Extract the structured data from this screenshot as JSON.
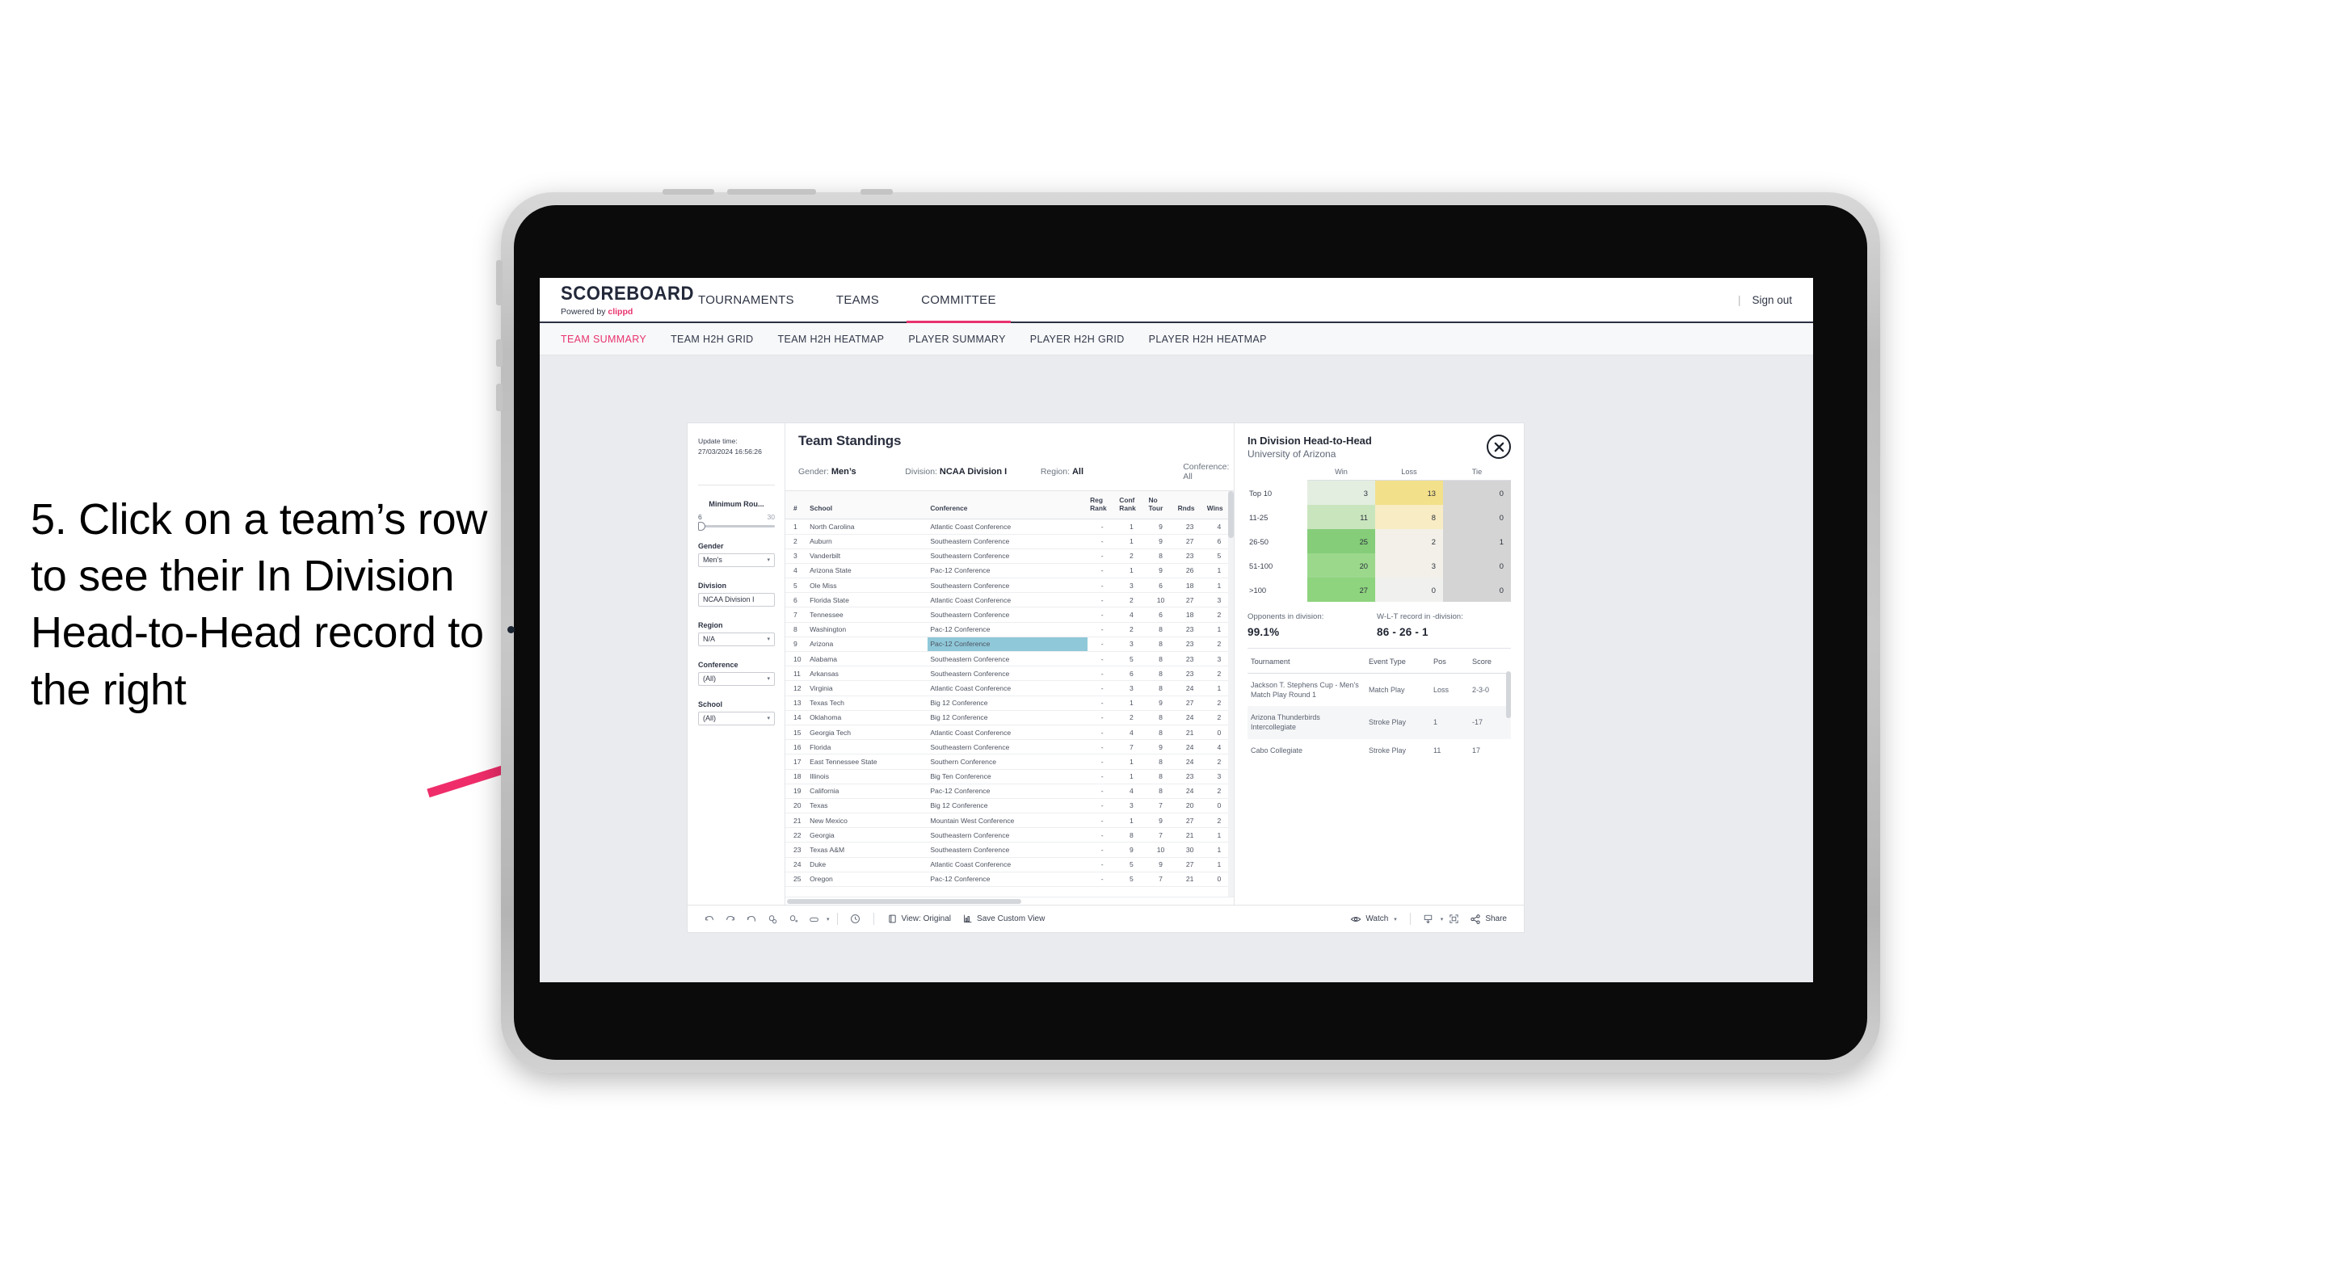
{
  "annotation": {
    "text": "5. Click on a team’s row to see their In Division Head-to-Head record to the right",
    "arrow_color": "#ef2d6a"
  },
  "topnav": {
    "brand_title": "SCOREBOARD",
    "brand_sub_prefix": "Powered by ",
    "brand_sub_accent": "clippd",
    "links": [
      {
        "label": "TOURNAMENTS",
        "active": false
      },
      {
        "label": "TEAMS",
        "active": false
      },
      {
        "label": "COMMITTEE",
        "active": true
      }
    ],
    "divider": "|",
    "signout": "Sign out"
  },
  "subnav": {
    "items": [
      {
        "label": "TEAM SUMMARY",
        "active": true
      },
      {
        "label": "TEAM H2H GRID",
        "active": false
      },
      {
        "label": "TEAM H2H HEATMAP",
        "active": false
      },
      {
        "label": "PLAYER SUMMARY",
        "active": false
      },
      {
        "label": "PLAYER H2H GRID",
        "active": false
      },
      {
        "label": "PLAYER H2H HEATMAP",
        "active": false
      }
    ]
  },
  "filters": {
    "update_time_label": "Update time:",
    "update_time_value": "27/03/2024 16:56:26",
    "min_rounds": {
      "label": "Minimum Rou...",
      "min": "6",
      "max": "30"
    },
    "selects": [
      {
        "label": "Gender",
        "value": "Men’s",
        "caret": "▾"
      },
      {
        "label": "Division",
        "value": "NCAA Division I",
        "caret": "▾"
      },
      {
        "label": "Region",
        "value": "N/A",
        "caret": "▾"
      },
      {
        "label": "Conference",
        "value": "(All)",
        "caret": "▾"
      },
      {
        "label": "School",
        "value": "(All)",
        "caret": "▾"
      }
    ]
  },
  "standings": {
    "title": "Team Standings",
    "facets": [
      {
        "label": "Gender: ",
        "value": "Men’s"
      },
      {
        "label": "Division: ",
        "value": "NCAA Division I"
      },
      {
        "label": "Region: ",
        "value": "All"
      },
      {
        "label": "Conference: ",
        "value": "All"
      }
    ],
    "columns": [
      "#",
      "School",
      "Conference",
      "Reg Rank",
      "Conf Rank",
      "No Tour",
      "Rnds",
      "Wins"
    ],
    "rows": [
      {
        "rank": "1",
        "school": "North Carolina",
        "conference": "Atlantic Coast Conference",
        "reg": "-",
        "conf": "1",
        "tour": "9",
        "rnds": "23",
        "wins": "4",
        "highlight": false
      },
      {
        "rank": "2",
        "school": "Auburn",
        "conference": "Southeastern Conference",
        "reg": "-",
        "conf": "1",
        "tour": "9",
        "rnds": "27",
        "wins": "6",
        "highlight": false
      },
      {
        "rank": "3",
        "school": "Vanderbilt",
        "conference": "Southeastern Conference",
        "reg": "-",
        "conf": "2",
        "tour": "8",
        "rnds": "23",
        "wins": "5",
        "highlight": false
      },
      {
        "rank": "4",
        "school": "Arizona State",
        "conference": "Pac-12 Conference",
        "reg": "-",
        "conf": "1",
        "tour": "9",
        "rnds": "26",
        "wins": "1",
        "highlight": false
      },
      {
        "rank": "5",
        "school": "Ole Miss",
        "conference": "Southeastern Conference",
        "reg": "-",
        "conf": "3",
        "tour": "6",
        "rnds": "18",
        "wins": "1",
        "highlight": false
      },
      {
        "rank": "6",
        "school": "Florida State",
        "conference": "Atlantic Coast Conference",
        "reg": "-",
        "conf": "2",
        "tour": "10",
        "rnds": "27",
        "wins": "3",
        "highlight": false
      },
      {
        "rank": "7",
        "school": "Tennessee",
        "conference": "Southeastern Conference",
        "reg": "-",
        "conf": "4",
        "tour": "6",
        "rnds": "18",
        "wins": "2",
        "highlight": false
      },
      {
        "rank": "8",
        "school": "Washington",
        "conference": "Pac-12 Conference",
        "reg": "-",
        "conf": "2",
        "tour": "8",
        "rnds": "23",
        "wins": "1",
        "highlight": false
      },
      {
        "rank": "9",
        "school": "Arizona",
        "conference": "Pac-12 Conference",
        "reg": "-",
        "conf": "3",
        "tour": "8",
        "rnds": "23",
        "wins": "2",
        "highlight": true
      },
      {
        "rank": "10",
        "school": "Alabama",
        "conference": "Southeastern Conference",
        "reg": "-",
        "conf": "5",
        "tour": "8",
        "rnds": "23",
        "wins": "3",
        "highlight": false
      },
      {
        "rank": "11",
        "school": "Arkansas",
        "conference": "Southeastern Conference",
        "reg": "-",
        "conf": "6",
        "tour": "8",
        "rnds": "23",
        "wins": "2",
        "highlight": false
      },
      {
        "rank": "12",
        "school": "Virginia",
        "conference": "Atlantic Coast Conference",
        "reg": "-",
        "conf": "3",
        "tour": "8",
        "rnds": "24",
        "wins": "1",
        "highlight": false
      },
      {
        "rank": "13",
        "school": "Texas Tech",
        "conference": "Big 12 Conference",
        "reg": "-",
        "conf": "1",
        "tour": "9",
        "rnds": "27",
        "wins": "2",
        "highlight": false
      },
      {
        "rank": "14",
        "school": "Oklahoma",
        "conference": "Big 12 Conference",
        "reg": "-",
        "conf": "2",
        "tour": "8",
        "rnds": "24",
        "wins": "2",
        "highlight": false
      },
      {
        "rank": "15",
        "school": "Georgia Tech",
        "conference": "Atlantic Coast Conference",
        "reg": "-",
        "conf": "4",
        "tour": "8",
        "rnds": "21",
        "wins": "0",
        "highlight": false
      },
      {
        "rank": "16",
        "school": "Florida",
        "conference": "Southeastern Conference",
        "reg": "-",
        "conf": "7",
        "tour": "9",
        "rnds": "24",
        "wins": "4",
        "highlight": false
      },
      {
        "rank": "17",
        "school": "East Tennessee State",
        "conference": "Southern Conference",
        "reg": "-",
        "conf": "1",
        "tour": "8",
        "rnds": "24",
        "wins": "2",
        "highlight": false
      },
      {
        "rank": "18",
        "school": "Illinois",
        "conference": "Big Ten Conference",
        "reg": "-",
        "conf": "1",
        "tour": "8",
        "rnds": "23",
        "wins": "3",
        "highlight": false
      },
      {
        "rank": "19",
        "school": "California",
        "conference": "Pac-12 Conference",
        "reg": "-",
        "conf": "4",
        "tour": "8",
        "rnds": "24",
        "wins": "2",
        "highlight": false
      },
      {
        "rank": "20",
        "school": "Texas",
        "conference": "Big 12 Conference",
        "reg": "-",
        "conf": "3",
        "tour": "7",
        "rnds": "20",
        "wins": "0",
        "highlight": false
      },
      {
        "rank": "21",
        "school": "New Mexico",
        "conference": "Mountain West Conference",
        "reg": "-",
        "conf": "1",
        "tour": "9",
        "rnds": "27",
        "wins": "2",
        "highlight": false
      },
      {
        "rank": "22",
        "school": "Georgia",
        "conference": "Southeastern Conference",
        "reg": "-",
        "conf": "8",
        "tour": "7",
        "rnds": "21",
        "wins": "1",
        "highlight": false
      },
      {
        "rank": "23",
        "school": "Texas A&M",
        "conference": "Southeastern Conference",
        "reg": "-",
        "conf": "9",
        "tour": "10",
        "rnds": "30",
        "wins": "1",
        "highlight": false
      },
      {
        "rank": "24",
        "school": "Duke",
        "conference": "Atlantic Coast Conference",
        "reg": "-",
        "conf": "5",
        "tour": "9",
        "rnds": "27",
        "wins": "1",
        "highlight": false
      },
      {
        "rank": "25",
        "school": "Oregon",
        "conference": "Pac-12 Conference",
        "reg": "-",
        "conf": "5",
        "tour": "7",
        "rnds": "21",
        "wins": "0",
        "highlight": false
      }
    ]
  },
  "h2h_panel": {
    "title": "In Division Head-to-Head",
    "subtitle": "University of Arizona",
    "close_icon": "close-icon",
    "columns": [
      "",
      "Win",
      "Loss",
      "Tie"
    ],
    "rows": [
      {
        "bucket": "Top 10",
        "win": "3",
        "loss": "13",
        "tie": "0",
        "win_color": "#e3eee1",
        "loss_color": "#f3e08a"
      },
      {
        "bucket": "11-25",
        "win": "11",
        "loss": "8",
        "tie": "0",
        "win_color": "#c9e5bd",
        "loss_color": "#f7ecc3"
      },
      {
        "bucket": "26-50",
        "win": "25",
        "loss": "2",
        "tie": "1",
        "win_color": "#86cd79",
        "loss_color": "#f2f0e8"
      },
      {
        "bucket": "51-100",
        "win": "20",
        "loss": "3",
        "tie": "0",
        "win_color": "#9bd88c",
        "loss_color": "#f2f0e8"
      },
      {
        "bucket": ">100",
        "win": "27",
        "loss": "0",
        "tie": "0",
        "win_color": "#8ed37e",
        "loss_color": "#f0f0ee"
      }
    ],
    "tie_color": "#d4d4d4",
    "kpis": [
      {
        "label": "Opponents in division:",
        "value": "99.1%"
      },
      {
        "label": "W-L-T record in -division:",
        "value": "86 - 26 - 1"
      }
    ],
    "tournaments": {
      "columns": [
        "Tournament",
        "Event Type",
        "Pos",
        "Score"
      ],
      "rows": [
        {
          "tournament": "Jackson T. Stephens Cup - Men’s Match Play Round 1",
          "event_type": "Match Play",
          "pos": "Loss",
          "score": "2-3-0"
        },
        {
          "tournament": "Arizona Thunderbirds Intercollegiate",
          "event_type": "Stroke Play",
          "pos": "1",
          "score": "-17"
        },
        {
          "tournament": "Cabo Collegiate",
          "event_type": "Stroke Play",
          "pos": "11",
          "score": "17"
        }
      ]
    }
  },
  "toolbar": {
    "view_label": "View: Original",
    "save_label": "Save Custom View",
    "watch_label": "Watch",
    "share_label": "Share",
    "caret": "▾"
  }
}
